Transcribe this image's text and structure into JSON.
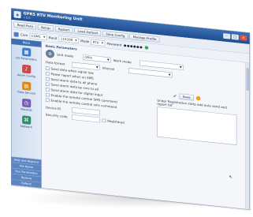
{
  "window": {
    "title": "GPRS RTU Monitoring Unit",
    "subtitle": "v 2.0",
    "controls": {
      "minimize": "–",
      "maximize": "□",
      "close": "×"
    }
  },
  "toolbar": {
    "buttons": [
      "Read Para",
      "Setup",
      "Restart",
      "Load Default",
      "Save Config",
      "Manage Profile"
    ]
  },
  "subbar": {
    "com_label": "Com",
    "com_value": "COM1",
    "baud_label": "Baud",
    "baud_value": "115200",
    "mode_label": "Mode",
    "mode_value": "RTU",
    "password_label": "Password",
    "password_value": "●●●●●●"
  },
  "sidebar": {
    "header": "Main",
    "items": [
      {
        "label": "I/O Parameters",
        "icon": "chip-icon",
        "color": "#3d7fc8"
      },
      {
        "label": "Alarm Config",
        "icon": "bell-icon",
        "color": "#c94a4a"
      },
      {
        "label": "Data Service",
        "icon": "server-icon",
        "color": "#d68a1c"
      },
      {
        "label": "Records",
        "icon": "clock-icon",
        "color": "#7a5bb5"
      },
      {
        "label": "Network",
        "icon": "network-icon",
        "color": "#2f8f6a"
      }
    ],
    "links": [
      "Help and Register",
      "File Name",
      "Run Parameters",
      "Restore",
      "Default"
    ]
  },
  "content": {
    "section_title": "Basic Parameters",
    "fields": [
      {
        "label": "Unit mode",
        "value": "GPRS"
      },
      {
        "label": "Work mode",
        "value": ""
      },
      {
        "label": "Data format",
        "value": ""
      },
      {
        "label": "Interval",
        "value": ""
      }
    ],
    "checkboxes": [
      "Send data when signal low",
      "Power report when on SMS",
      "Send alarm data to all phone",
      "Send alarm data by sms to all",
      "Send alarm data for digital input",
      "Enable the remote control SMS command",
      "Enable the remote control sms command"
    ],
    "report_label": "Under Registration state add auto send and report list",
    "bottom_fields": [
      {
        "label": "Device ID",
        "value": ""
      },
      {
        "label": "Security code",
        "value": ""
      }
    ],
    "save_label": "Save",
    "checkbox_label": "Registered"
  }
}
